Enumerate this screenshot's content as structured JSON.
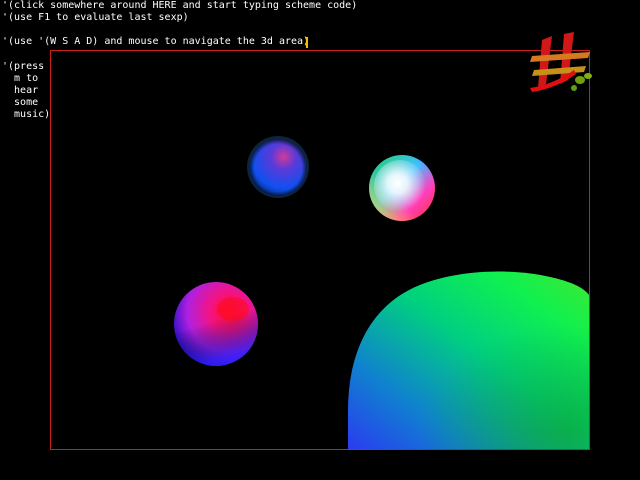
{
  "repl": {
    "line1": "'(click somewhere around HERE and start typing scheme code)",
    "line2": "'(use F1 to evaluate last sexp)",
    "line3": "'(use '(W S A D) and mouse to navigate the 3d area)",
    "music_hint": "'(press\n  m to\n  hear\n  some\n  music)"
  },
  "colors": {
    "background": "#000000",
    "viewport_border": "#cc2020",
    "caret": "#f0c000",
    "text": "#ffffff"
  },
  "scene": {
    "objects": [
      "blue-sphere",
      "rainbow-sphere",
      "magenta-sphere",
      "green-blob"
    ]
  },
  "logo": {
    "icon": "hash-logo-icon"
  }
}
